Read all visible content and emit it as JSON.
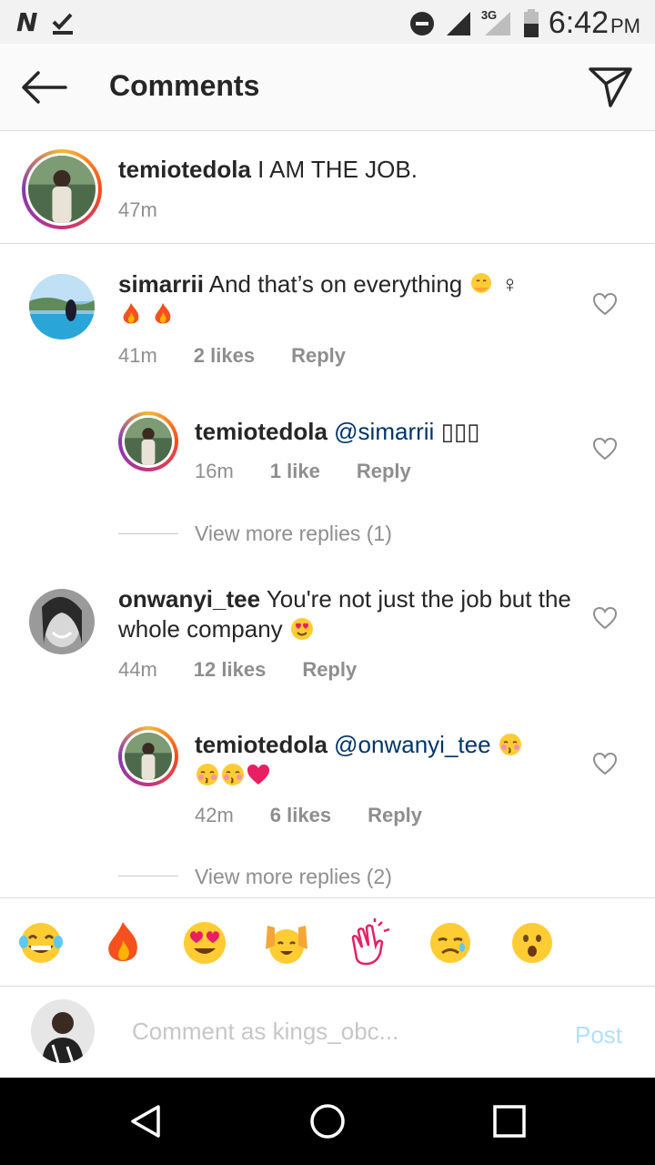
{
  "status_bar": {
    "left_icons": [
      "notification-n-icon",
      "download-done-icon"
    ],
    "network_label": "3G",
    "time": "6:42",
    "ampm": "PM"
  },
  "header": {
    "title": "Comments"
  },
  "caption": {
    "username": "temiotedola",
    "text": "I AM THE JOB.",
    "time": "47m"
  },
  "comments": [
    {
      "username": "simarrii",
      "text": "And that’s on everything",
      "trailing_glyph": "♀",
      "time": "41m",
      "likes": "2 likes",
      "reply_label": "Reply"
    },
    {
      "username": "temiotedola",
      "mention": "@simarrii",
      "trailing_glyphs": "▯▯▯",
      "time": "16m",
      "likes": "1 like",
      "reply_label": "Reply"
    },
    {
      "username": "onwanyi_tee",
      "text": "You're not just the job but the whole company",
      "time": "44m",
      "likes": "12 likes",
      "reply_label": "Reply"
    },
    {
      "username": "temiotedola",
      "mention": "@onwanyi_tee",
      "time": "42m",
      "likes": "6 likes",
      "reply_label": "Reply"
    }
  ],
  "view_more": [
    "View more replies (1)",
    "View more replies (2)"
  ],
  "emoji_bar": [
    "laughing-tears",
    "fire",
    "heart-eyes",
    "raised-hands",
    "clapping-hands",
    "crying-face",
    "surprised-face"
  ],
  "input": {
    "placeholder": "Comment as kings_obc...",
    "post_label": "Post"
  },
  "colors": {
    "accent_post_disabled": "#b2dffc",
    "mention": "#003569",
    "secondary_text": "#8e8e8e"
  }
}
